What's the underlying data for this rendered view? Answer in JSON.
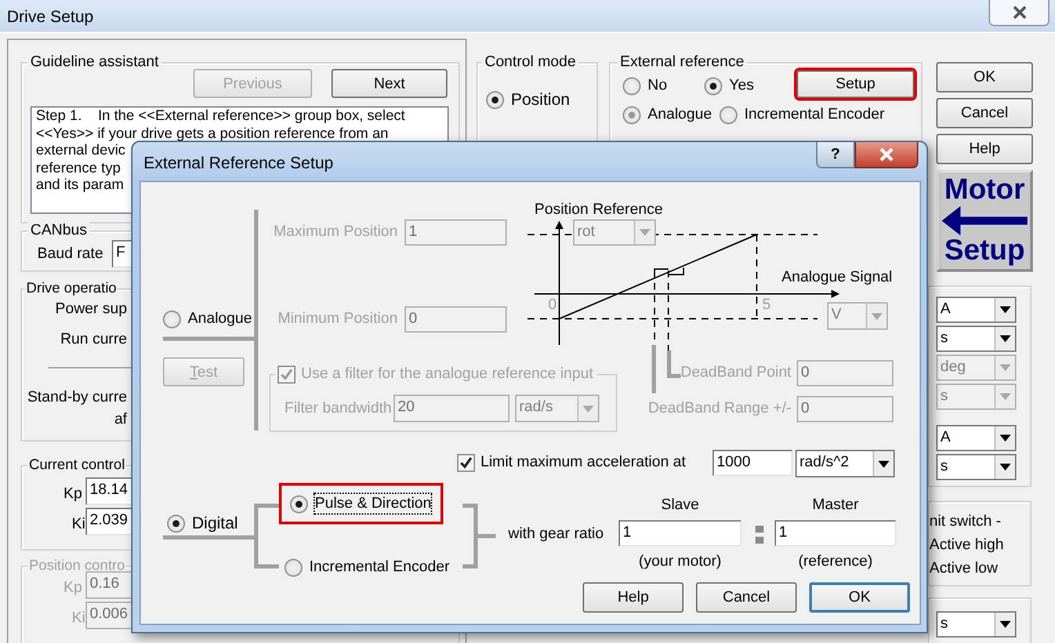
{
  "window": {
    "title": "Drive Setup"
  },
  "guideline": {
    "title": "Guideline assistant",
    "buttons": [
      {
        "label": "Previous",
        "disabled": true
      },
      {
        "label": "Next",
        "disabled": false
      }
    ],
    "lines": [
      "Step 1.    In the <<External reference>> group box, select",
      "<<Yes>> if your drive gets a position reference from an",
      "external devic",
      "reference typ",
      "and its param"
    ]
  },
  "canbus": {
    "title": "CANbus",
    "label": "Baud rate",
    "value": "F"
  },
  "drive_operation": {
    "title": "Drive operatio",
    "labels": [
      "Power sup",
      "Run curre",
      "Stand-by curre",
      "af"
    ]
  },
  "current_control": {
    "title": "Current control",
    "disabled": false,
    "rows": [
      {
        "label": "Kp",
        "value": "18.14"
      },
      {
        "label": "Ki",
        "value": "2.039"
      }
    ]
  },
  "position_control": {
    "title": "Position contro",
    "disabled": true,
    "rows": [
      {
        "label": "Kp",
        "value": "0.16"
      },
      {
        "label": "Ki",
        "value": "0.006"
      }
    ]
  },
  "control_mode": {
    "title": "Control mode",
    "options": [
      {
        "label": "Position",
        "selected": true
      }
    ]
  },
  "external_reference": {
    "title": "External reference",
    "source": [
      {
        "label": "No",
        "selected": false
      },
      {
        "label": "Yes",
        "selected": true
      }
    ],
    "setup": {
      "label": "Setup",
      "highlighted": true
    },
    "types": [
      {
        "label": "Analogue",
        "selected": true
      },
      {
        "label": "Incremental Encoder",
        "selected": false
      }
    ]
  },
  "side_buttons": [
    {
      "label": "OK"
    },
    {
      "label": "Cancel"
    },
    {
      "label": "Help"
    }
  ],
  "motor_setup": {
    "top": "Motor",
    "bottom": "Setup"
  },
  "unit_groups": [
    {
      "combos": [
        {
          "value": "A",
          "disabled": false
        },
        {
          "value": "s",
          "disabled": false
        },
        {
          "value": "deg",
          "disabled": true
        },
        {
          "value": "s",
          "disabled": true
        }
      ]
    },
    {
      "combos": [
        {
          "value": "A",
          "disabled": false
        },
        {
          "value": "s",
          "disabled": false
        }
      ]
    }
  ],
  "limit_switch": {
    "lines": [
      "nit switch -",
      "Active high",
      "Active low"
    ]
  },
  "bottom_combo": {
    "value": "s",
    "disabled": false
  },
  "dialog": {
    "title": "External Reference Setup",
    "help": "?",
    "analogue": {
      "label": "Analogue",
      "selected": false,
      "disabled": true,
      "test_button": "Test",
      "max_position": {
        "label": "Maximum Position",
        "value": "1"
      },
      "min_position": {
        "label": "Minimum Position",
        "value": "0"
      },
      "filter": {
        "label": "Use a filter for the analogue reference input",
        "checked": true,
        "bandwidth_label": "Filter bandwidth",
        "bandwidth": "20",
        "unit": "rad/s"
      },
      "chart": {
        "y_label": "Position Reference",
        "y_unit": "rot",
        "x_label": "Analogue Signal",
        "x_unit": "V",
        "origin": "0",
        "x_max": "5"
      },
      "deadband_point": {
        "label": "DeadBand Point",
        "value": "0"
      },
      "deadband_range": {
        "label": "DeadBand Range +/-",
        "value": "0"
      }
    },
    "acceleration": {
      "label": "Limit maximum acceleration at",
      "checked": true,
      "value": "1000",
      "unit": "rad/s^2"
    },
    "digital": {
      "label": "Digital",
      "selected": true,
      "modes": [
        {
          "label": "Pulse & Direction",
          "selected": true,
          "highlighted": true
        },
        {
          "label": "Incremental Encoder",
          "selected": false,
          "highlighted": false
        }
      ],
      "gear_label": "with gear ratio",
      "slave": {
        "heading": "Slave",
        "value": "1",
        "caption": "(your motor)"
      },
      "master": {
        "heading": "Master",
        "value": "1",
        "caption": "(reference)"
      }
    },
    "buttons": [
      {
        "label": "Help",
        "default": false
      },
      {
        "label": "Cancel",
        "default": false
      },
      {
        "label": "OK",
        "default": true
      }
    ]
  }
}
